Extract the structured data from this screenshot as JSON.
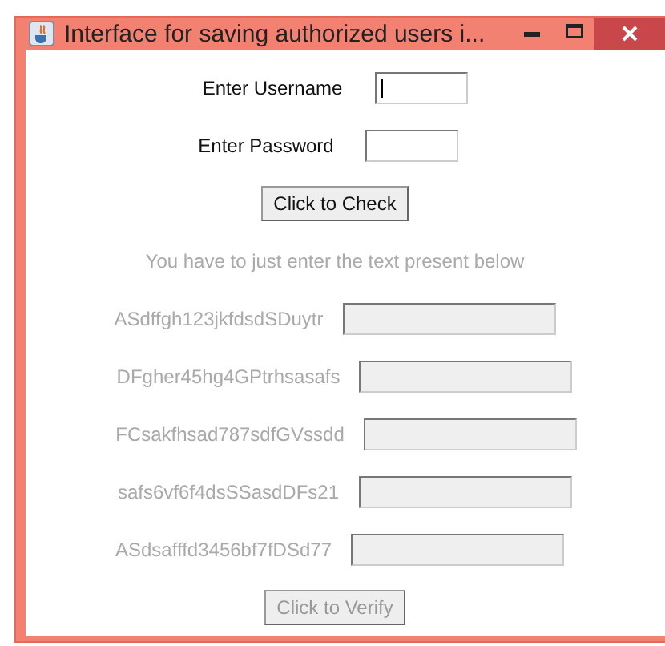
{
  "window": {
    "title": "Interface for saving authorized users i..."
  },
  "login": {
    "fields": [
      {
        "label": "Enter Username",
        "focused": true
      },
      {
        "label": "Enter Password",
        "focused": false
      }
    ],
    "button": "Click to Check"
  },
  "verify": {
    "disabled": true,
    "instruction": "You have to just enter the text present below",
    "codes": [
      {
        "text": "ASdffgh123jkfdsdSDuytr"
      },
      {
        "text": "DFgher45hg4GPtrhsasafs"
      },
      {
        "text": "FCsakfhsad787sdfGVssdd"
      },
      {
        "text": "safs6vf6f4dsSSasdDFs21"
      },
      {
        "text": "ASdsafffd3456bf7fDSd77"
      }
    ],
    "button": "Click to Verify"
  }
}
